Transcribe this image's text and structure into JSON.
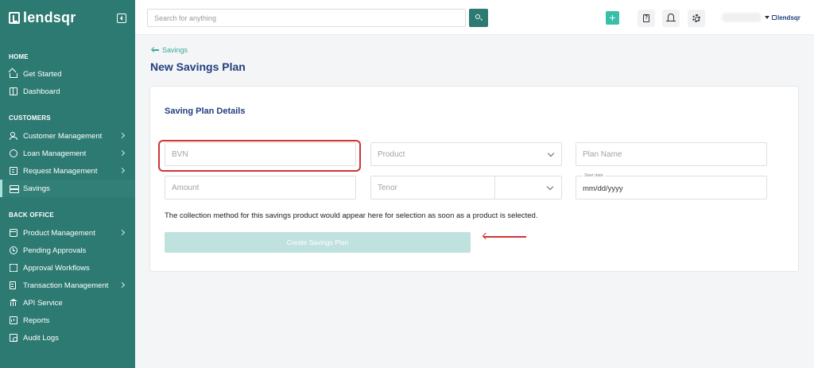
{
  "brand": {
    "name": "lendsqr"
  },
  "sidebar": {
    "sections": [
      {
        "label": "HOME"
      },
      {
        "label": "CUSTOMERS"
      },
      {
        "label": "BACK OFFICE"
      }
    ],
    "items": [
      {
        "label": "Get Started",
        "icon": "home-icon"
      },
      {
        "label": "Dashboard",
        "icon": "dashboard-icon"
      },
      {
        "label": "Customer Management",
        "icon": "users-icon",
        "has_submenu": true
      },
      {
        "label": "Loan Management",
        "icon": "coins-icon",
        "has_submenu": true
      },
      {
        "label": "Request Management",
        "icon": "request-icon",
        "has_submenu": true
      },
      {
        "label": "Savings",
        "icon": "savings-icon",
        "active": true
      },
      {
        "label": "Product Management",
        "icon": "box-icon",
        "has_submenu": true
      },
      {
        "label": "Pending Approvals",
        "icon": "clock-icon"
      },
      {
        "label": "Approval Workflows",
        "icon": "workflow-icon"
      },
      {
        "label": "Transaction Management",
        "icon": "document-icon",
        "has_submenu": true
      },
      {
        "label": "API Service",
        "icon": "bank-icon"
      },
      {
        "label": "Reports",
        "icon": "chart-icon"
      },
      {
        "label": "Audit Logs",
        "icon": "audit-icon"
      }
    ]
  },
  "topbar": {
    "search_placeholder": "Search for anything",
    "user_logo_text": "lendsqr"
  },
  "main": {
    "back_label": "Savings",
    "page_title": "New Savings Plan",
    "form": {
      "section_title": "Saving Plan Details",
      "bvn_placeholder": "BVN",
      "product_placeholder": "Product",
      "plan_name_placeholder": "Plan Name",
      "amount_placeholder": "Amount",
      "tenor_placeholder": "Tenor",
      "start_date_label": "Start date",
      "start_date_value": "mm/dd/yyyy",
      "collection_info": "The collection method for this savings product would appear here for selection as soon as a product is selected.",
      "submit_label": "Create Savings Plan"
    }
  },
  "colors": {
    "sidebar_bg": "#2d7a73",
    "accent": "#39bfa8",
    "title": "#213f7d",
    "annotation_red": "#d03535"
  }
}
